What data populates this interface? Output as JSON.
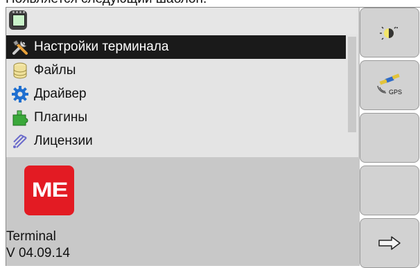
{
  "caption": "Появляется следующий шаблон:",
  "topbar": {
    "icon": "terminal-icon"
  },
  "menu": {
    "items": [
      {
        "label": "Настройки терминала",
        "icon": "tools-icon",
        "selected": true
      },
      {
        "label": "Файлы",
        "icon": "database-icon",
        "selected": false
      },
      {
        "label": "Драйвер",
        "icon": "gear-icon",
        "selected": false
      },
      {
        "label": "Плагины",
        "icon": "puzzle-icon",
        "selected": false
      },
      {
        "label": "Лицензии",
        "icon": "license-icon",
        "selected": false
      }
    ]
  },
  "info": {
    "logo_text": "ME",
    "product": "Terminal",
    "version": "V 04.09.14"
  },
  "softkeys": [
    {
      "icon": "brightness-icon"
    },
    {
      "icon": "gps-icon",
      "label": "GPS"
    },
    {
      "icon": ""
    },
    {
      "icon": ""
    },
    {
      "icon": "arrow-right-icon"
    }
  ],
  "colors": {
    "selection": "#1a1a1a",
    "logo": "#e31b23",
    "panel": "#c8c8c8"
  }
}
